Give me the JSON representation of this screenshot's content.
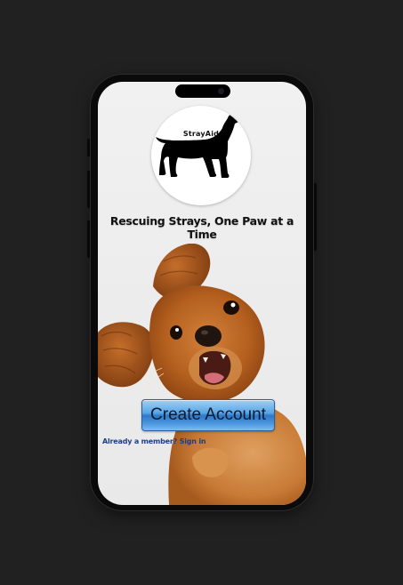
{
  "app": {
    "brand_name": "StrayAid",
    "tagline": "Rescuing Strays, One Paw at a Time"
  },
  "actions": {
    "create_account_label": "Create Account",
    "sign_in_label": "Already a member? Sign in"
  },
  "images": {
    "logo_icon": "dog-silhouette-icon",
    "hero": "puppy-photo"
  },
  "colors": {
    "background": "#212121",
    "screen": "#eeeeee",
    "button_blue": "#4f9ae0",
    "link_blue": "#1c3f8a",
    "dog_fur": "#b5601f"
  }
}
